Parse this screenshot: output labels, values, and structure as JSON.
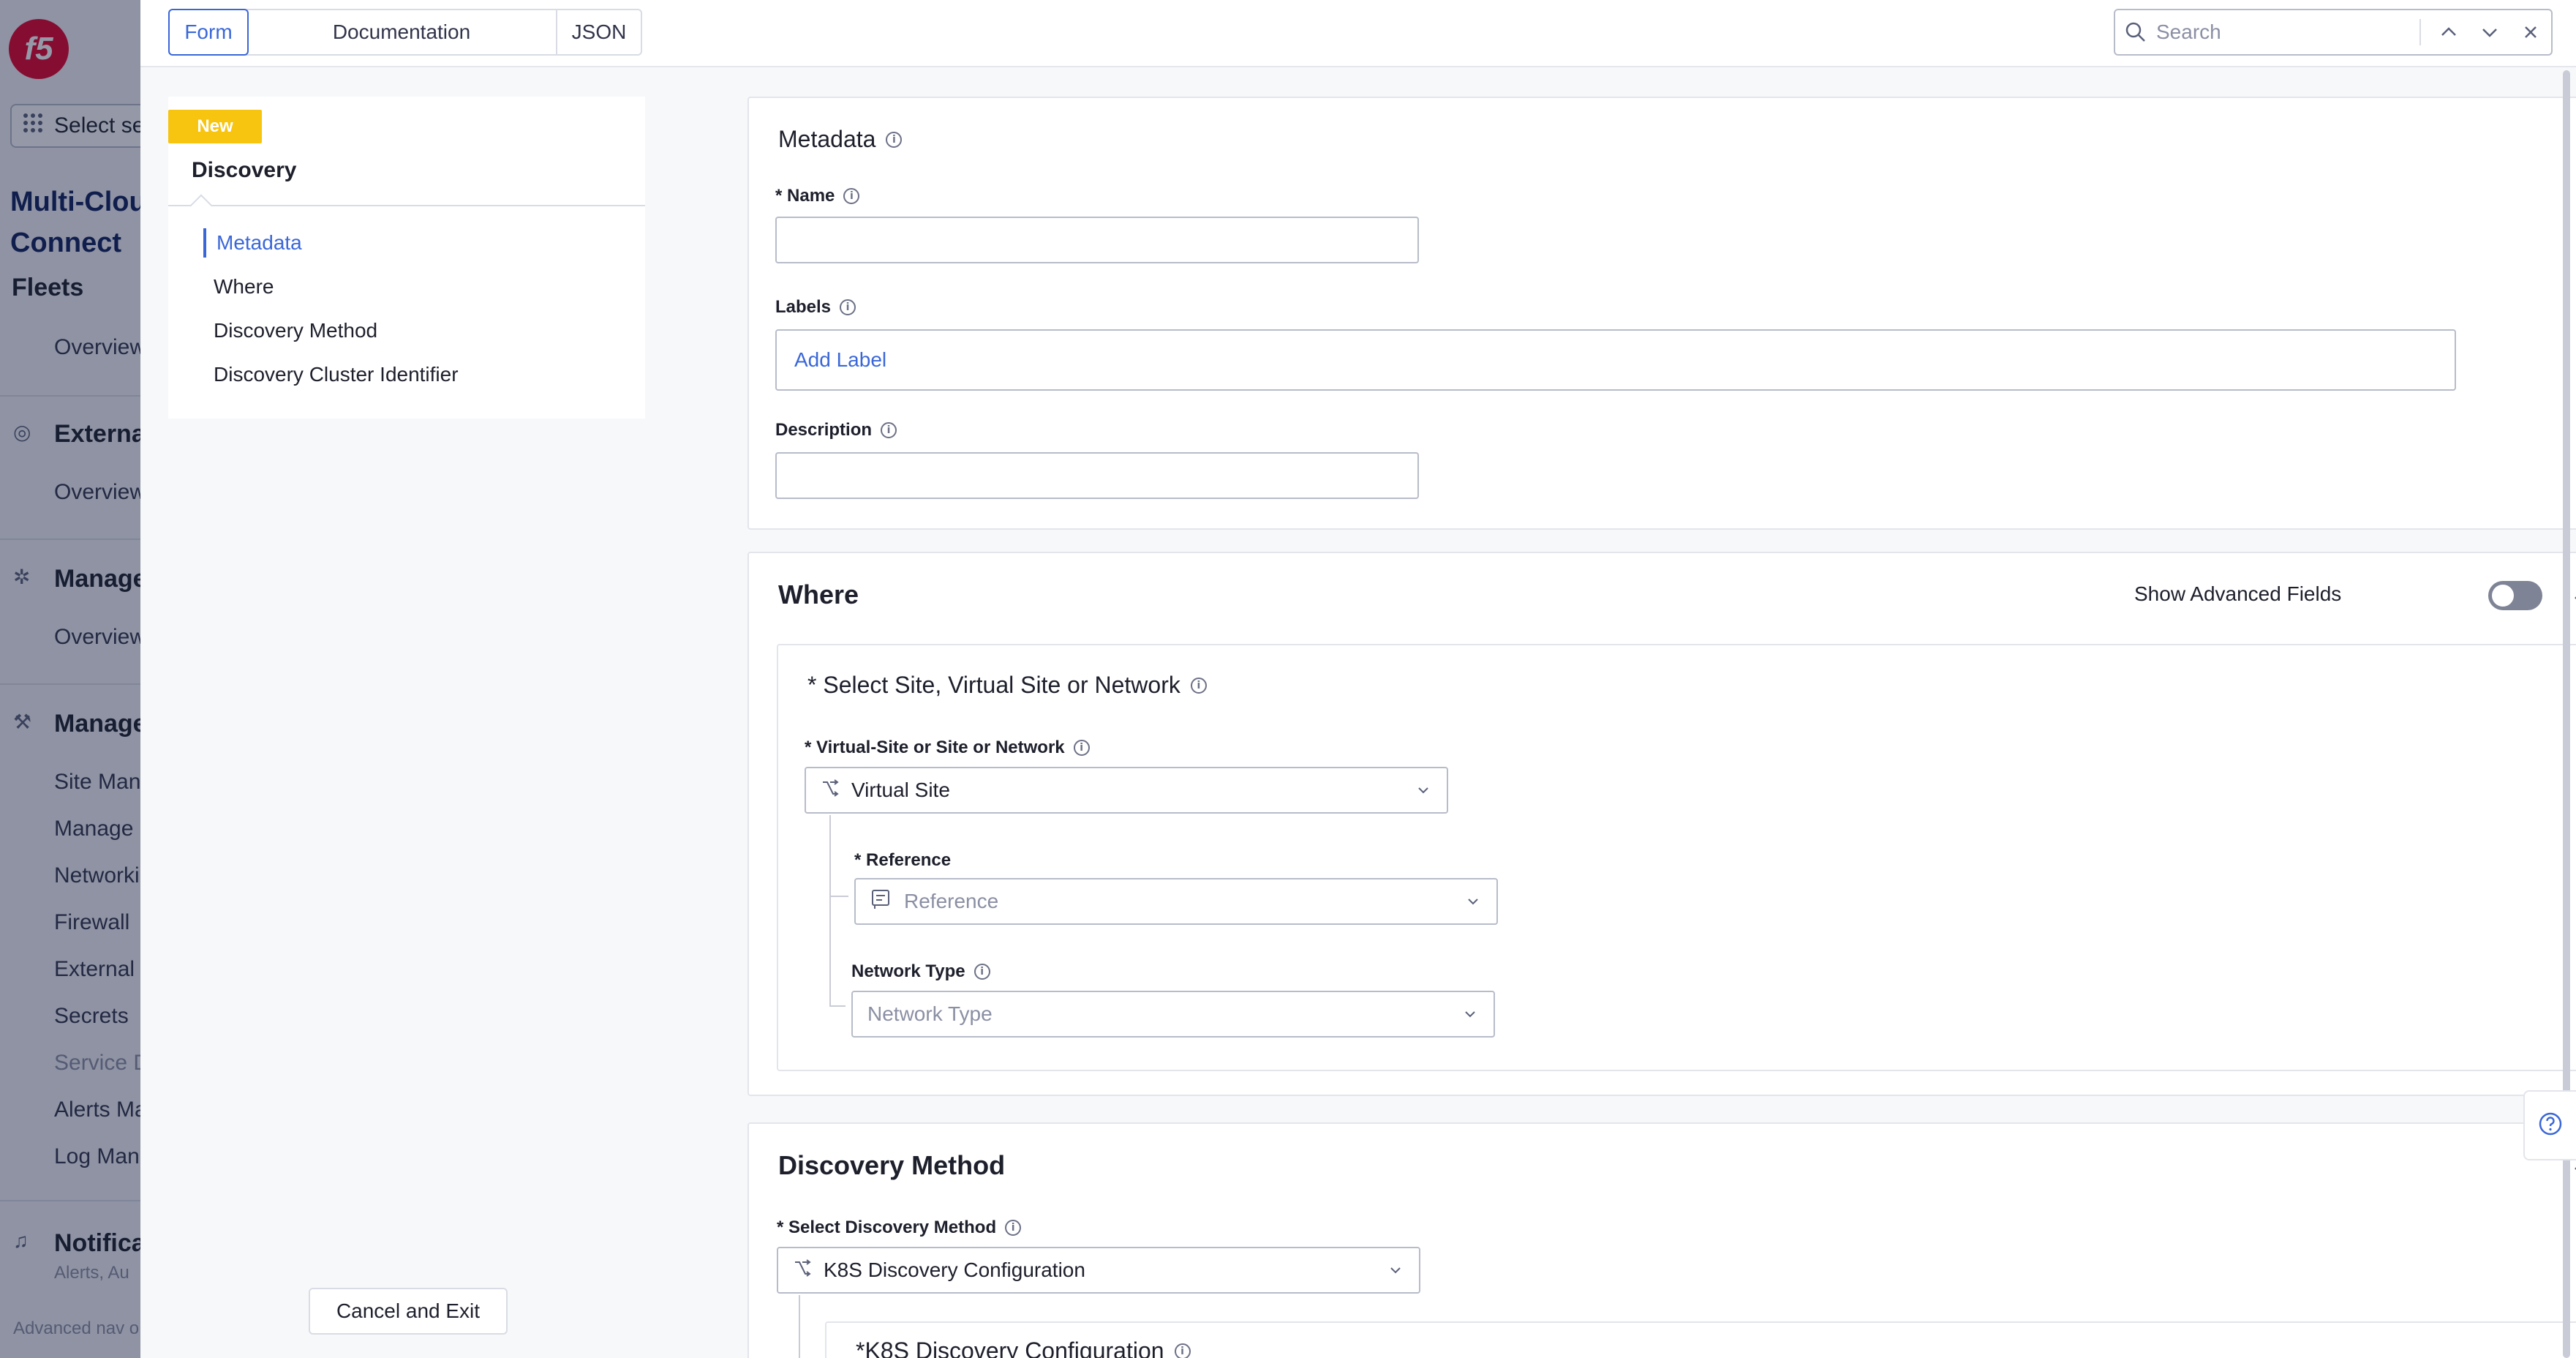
{
  "background_app": {
    "workspace_select": "Select se",
    "app_title_line1": "Multi-Clou",
    "app_title_line2": "Connect",
    "sections": [
      {
        "title": "Fleets",
        "items": [
          "Overview"
        ]
      },
      {
        "title": "Externa",
        "items": [
          "Overview"
        ]
      },
      {
        "title": "Manage",
        "items": [
          "Overview"
        ]
      },
      {
        "title": "Manage",
        "items": [
          "Site Man",
          "Manage I",
          "Networki",
          "Firewall",
          "External",
          "Secrets",
          "Service D",
          "Alerts Ma",
          "Log Mana"
        ]
      },
      {
        "title": "Notificat",
        "items": [
          "Alerts, Au"
        ]
      }
    ],
    "footer_text": "Advanced nav o"
  },
  "topbar": {
    "tabs": [
      "Form",
      "Documentation",
      "JSON"
    ],
    "active_tab": "Form",
    "search_placeholder": "Search"
  },
  "nav": {
    "badge": "New",
    "title": "Discovery",
    "items": [
      "Metadata",
      "Where",
      "Discovery Method",
      "Discovery Cluster Identifier"
    ],
    "active_item": "Metadata",
    "cancel_label": "Cancel and Exit"
  },
  "metadata": {
    "title": "Metadata",
    "name_label": "* Name",
    "name_value": "",
    "labels_label": "Labels",
    "labels_placeholder": "Add Label",
    "description_label": "Description",
    "description_value": ""
  },
  "where": {
    "title": "Where",
    "show_advanced_label": "Show Advanced Fields",
    "show_advanced_on": false,
    "subsection_title": "* Select Site, Virtual Site or Network",
    "choice_label": "* Virtual-Site or Site or Network",
    "choice_value": "Virtual Site",
    "reference_label": "* Reference",
    "reference_placeholder": "Reference",
    "network_type_label": "Network Type",
    "network_type_placeholder": "Network Type"
  },
  "discovery_method": {
    "title": "Discovery Method",
    "select_label": "* Select Discovery Method",
    "select_value": "K8S Discovery Configuration",
    "sub_title": "*K8S Discovery Configuration"
  },
  "colors": {
    "accent": "#3a67d8",
    "badge": "#f7c40f",
    "brand": "#e4002b"
  }
}
